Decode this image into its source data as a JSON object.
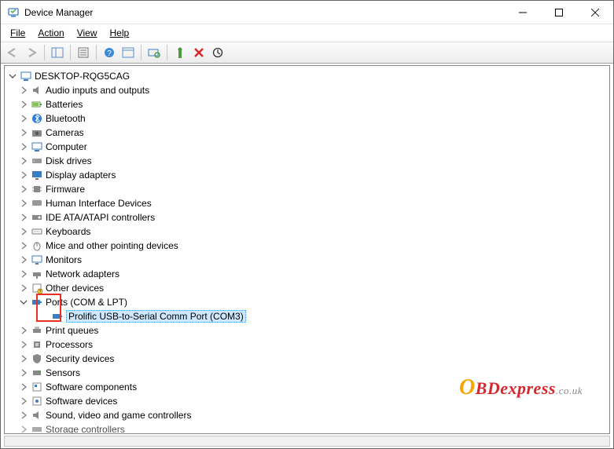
{
  "window": {
    "title": "Device Manager"
  },
  "menu": {
    "file": "File",
    "action": "Action",
    "view": "View",
    "help": "Help"
  },
  "tree": {
    "root": "DESKTOP-RQG5CAG",
    "cats": {
      "audio": "Audio inputs and outputs",
      "batt": "Batteries",
      "bt": "Bluetooth",
      "cam": "Cameras",
      "comp": "Computer",
      "disk": "Disk drives",
      "disp": "Display adapters",
      "fw": "Firmware",
      "hid": "Human Interface Devices",
      "ide": "IDE ATA/ATAPI controllers",
      "kb": "Keyboards",
      "mouse": "Mice and other pointing devices",
      "mon": "Monitors",
      "net": "Network adapters",
      "oth": "Other devices",
      "ports": "Ports (COM & LPT)",
      "port_child": "Prolific USB-to-Serial Comm Port (COM3)",
      "pq": "Print queues",
      "proc": "Processors",
      "sec": "Security devices",
      "sens": "Sensors",
      "swc": "Software components",
      "swd": "Software devices",
      "svgc": "Sound, video and game controllers",
      "stor": "Storage controllers"
    }
  },
  "watermark": {
    "o": "O",
    "brand": "BDexpress",
    "suffix": ".co.uk"
  }
}
